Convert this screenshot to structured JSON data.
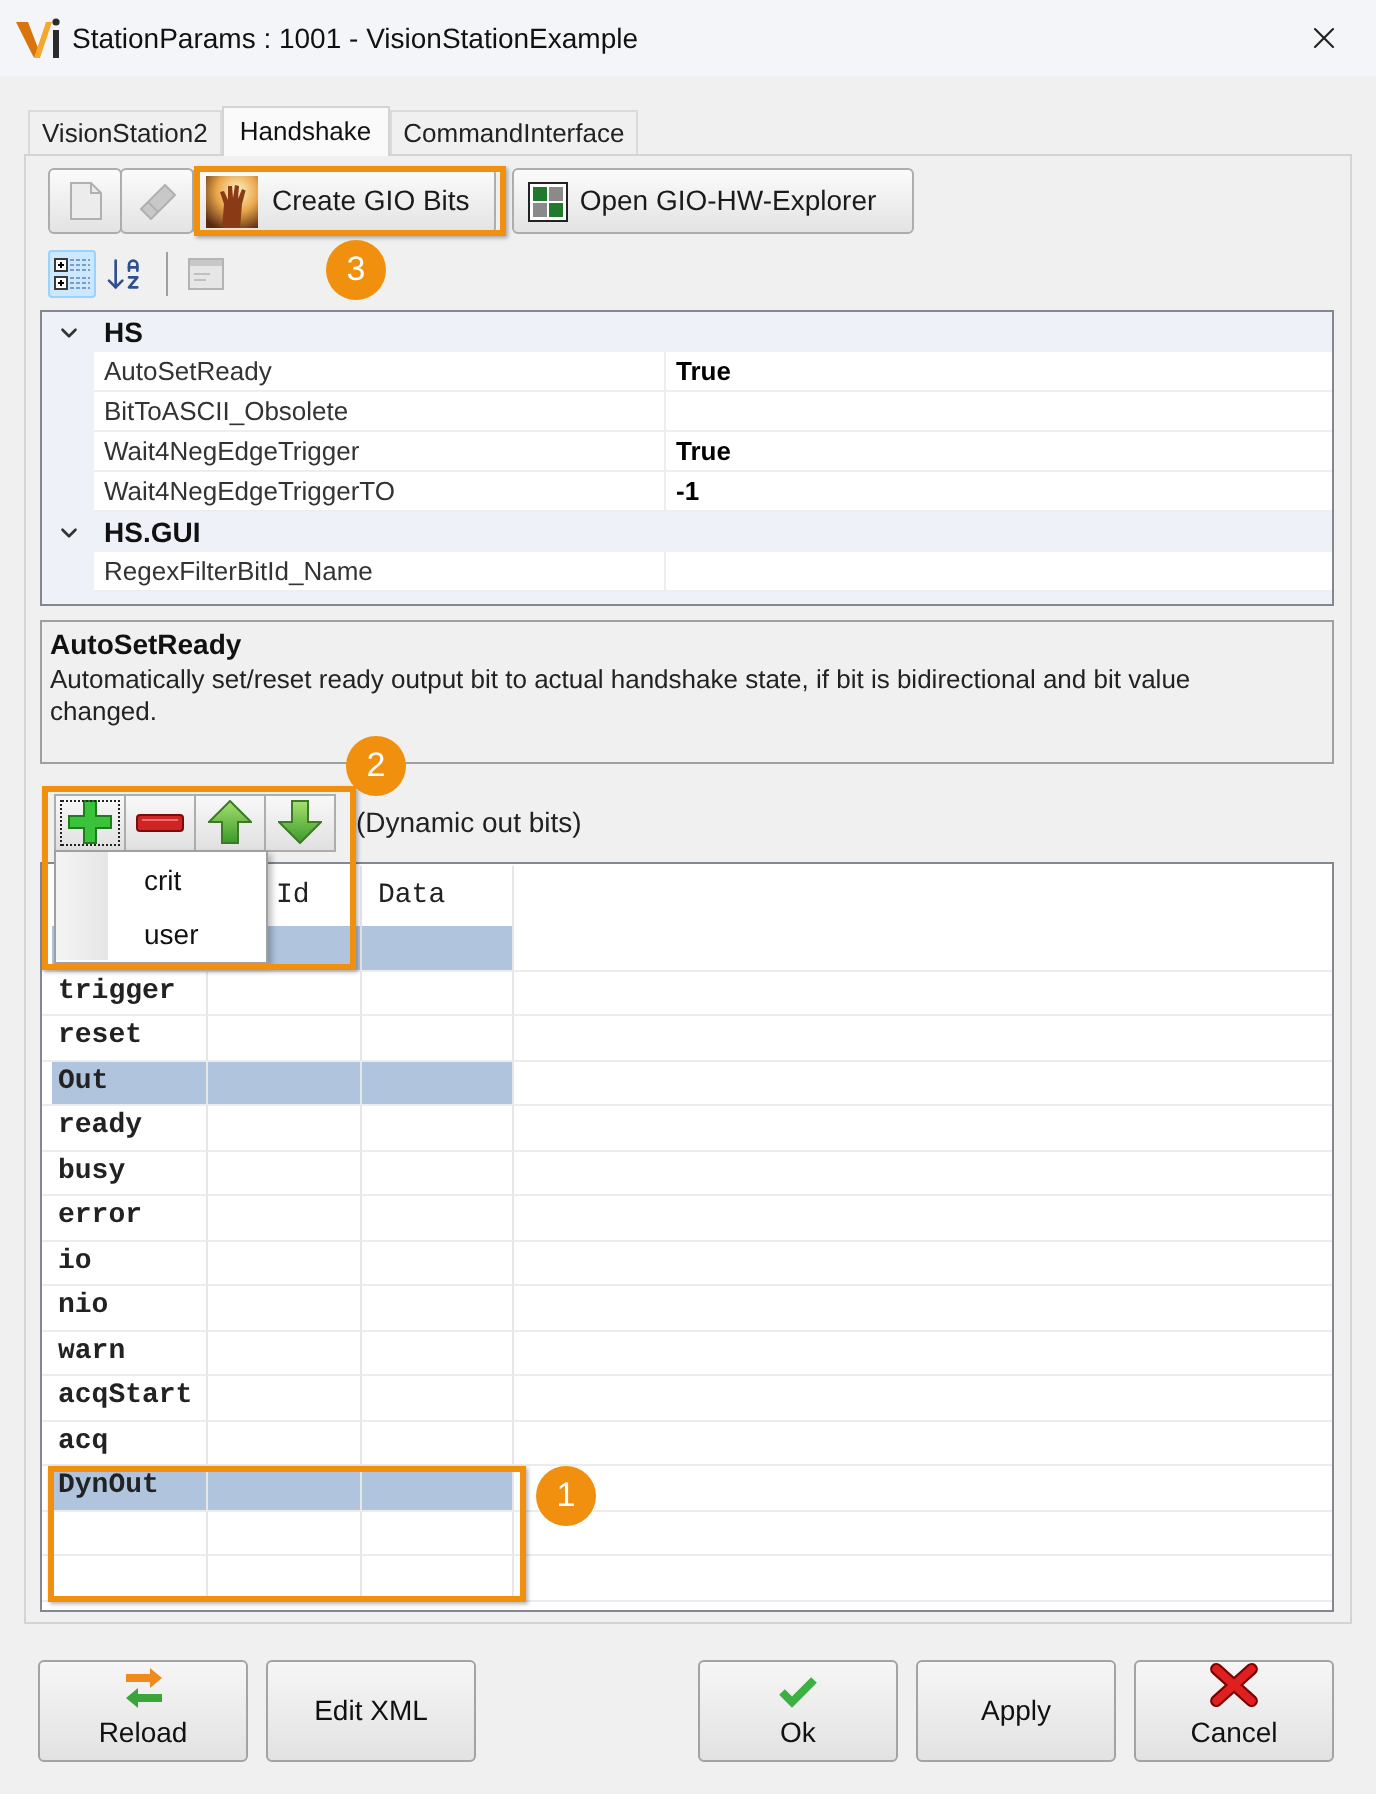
{
  "window": {
    "title": "StationParams : 1001 - VisionStationExample"
  },
  "tabs": [
    {
      "label": "VisionStation2",
      "selected": false
    },
    {
      "label": "Handshake",
      "selected": true
    },
    {
      "label": "CommandInterface",
      "selected": false
    }
  ],
  "toolbar": {
    "buttons": [
      {
        "kind": "new",
        "disabled": true
      },
      {
        "kind": "eraser",
        "disabled": true
      },
      {
        "kind": "create",
        "label": "Create GIO Bits",
        "disabled": false
      },
      {
        "kind": "explorer",
        "label": "Open GIO-HW-Explorer",
        "disabled": false
      }
    ],
    "callout": "3"
  },
  "grid_toolbar": {
    "views": [
      {
        "kind": "categorized",
        "selected": true
      },
      {
        "kind": "alphabetical",
        "selected": false
      }
    ],
    "pages_button": {
      "disabled": true
    }
  },
  "property_grid": {
    "categories": [
      {
        "name": "HS",
        "expanded": true,
        "properties": [
          {
            "name": "AutoSetReady",
            "value": "True"
          },
          {
            "name": "BitToASCII_Obsolete"
          },
          {
            "name": "Wait4NegEdgeTrigger",
            "value": "True"
          },
          {
            "name": "Wait4NegEdgeTriggerTO",
            "value": "-1"
          }
        ]
      },
      {
        "name": "HS.GUI",
        "expanded": true,
        "properties": [
          {
            "name": "RegexFilterBitId_Name"
          }
        ]
      }
    ]
  },
  "description": {
    "title": "AutoSetReady",
    "text": "Automatically set/reset ready output bit to actual handshake state, if bit is bidirectional and bit value changed."
  },
  "bits_toolbar": {
    "buttons": [
      {
        "kind": "add",
        "focused": true
      },
      {
        "kind": "remove",
        "focused": false
      },
      {
        "kind": "up",
        "focused": false
      },
      {
        "kind": "down",
        "focused": false
      }
    ],
    "caption": "(Dynamic out bits)",
    "callout": "2"
  },
  "add_menu": {
    "items": [
      {
        "label": "crit"
      },
      {
        "label": "user"
      }
    ]
  },
  "bits_table": {
    "header": {
      "column_2": "Id",
      "column_3": "Data"
    },
    "rows": [
      {
        "selected": true
      },
      {
        "name": "trigger",
        "selected": false
      },
      {
        "name": "reset",
        "selected": false
      },
      {
        "name": "Out",
        "selected": true
      },
      {
        "name": "ready",
        "selected": false
      },
      {
        "name": "busy",
        "selected": false
      },
      {
        "name": "error",
        "selected": false
      },
      {
        "name": "io",
        "selected": false
      },
      {
        "name": "nio",
        "selected": false
      },
      {
        "name": "warn",
        "selected": false
      },
      {
        "name": "acqStart",
        "selected": false
      },
      {
        "name": "acq",
        "selected": false
      },
      {
        "name": "DynOut",
        "selected": true
      },
      {
        "selected": false
      },
      {
        "selected": false
      }
    ],
    "callout": "1"
  },
  "footer": {
    "left": [
      {
        "kind": "reload",
        "label": "Reload"
      },
      {
        "kind": "plain",
        "label": "Edit XML"
      }
    ],
    "right": [
      {
        "kind": "ok",
        "label": "Ok"
      },
      {
        "kind": "plain",
        "label": "Apply"
      },
      {
        "kind": "cancel",
        "label": "Cancel"
      }
    ]
  }
}
